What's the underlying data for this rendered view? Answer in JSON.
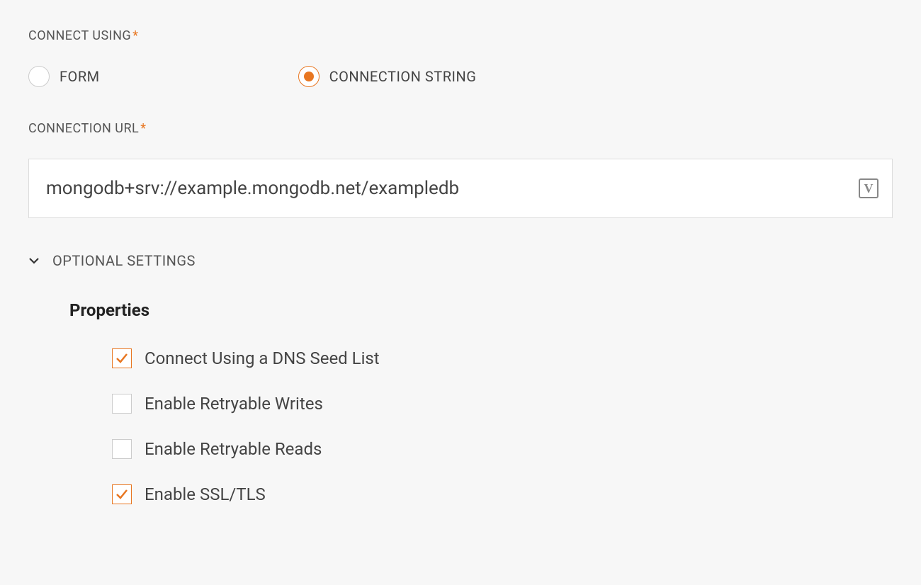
{
  "connect_using": {
    "label": "CONNECT USING",
    "required_marker": "*",
    "options": [
      {
        "label": "FORM",
        "selected": false
      },
      {
        "label": "CONNECTION STRING",
        "selected": true
      }
    ]
  },
  "connection_url": {
    "label": "CONNECTION URL",
    "required_marker": "*",
    "value": "mongodb+srv://example.mongodb.net/exampledb",
    "vault_icon_glyph": "V"
  },
  "optional_settings": {
    "label": "OPTIONAL SETTINGS",
    "expanded": true,
    "properties_title": "Properties",
    "properties": [
      {
        "label": "Connect Using a DNS Seed List",
        "checked": true
      },
      {
        "label": "Enable Retryable Writes",
        "checked": false
      },
      {
        "label": "Enable Retryable Reads",
        "checked": false
      },
      {
        "label": "Enable SSL/TLS",
        "checked": true
      }
    ]
  }
}
